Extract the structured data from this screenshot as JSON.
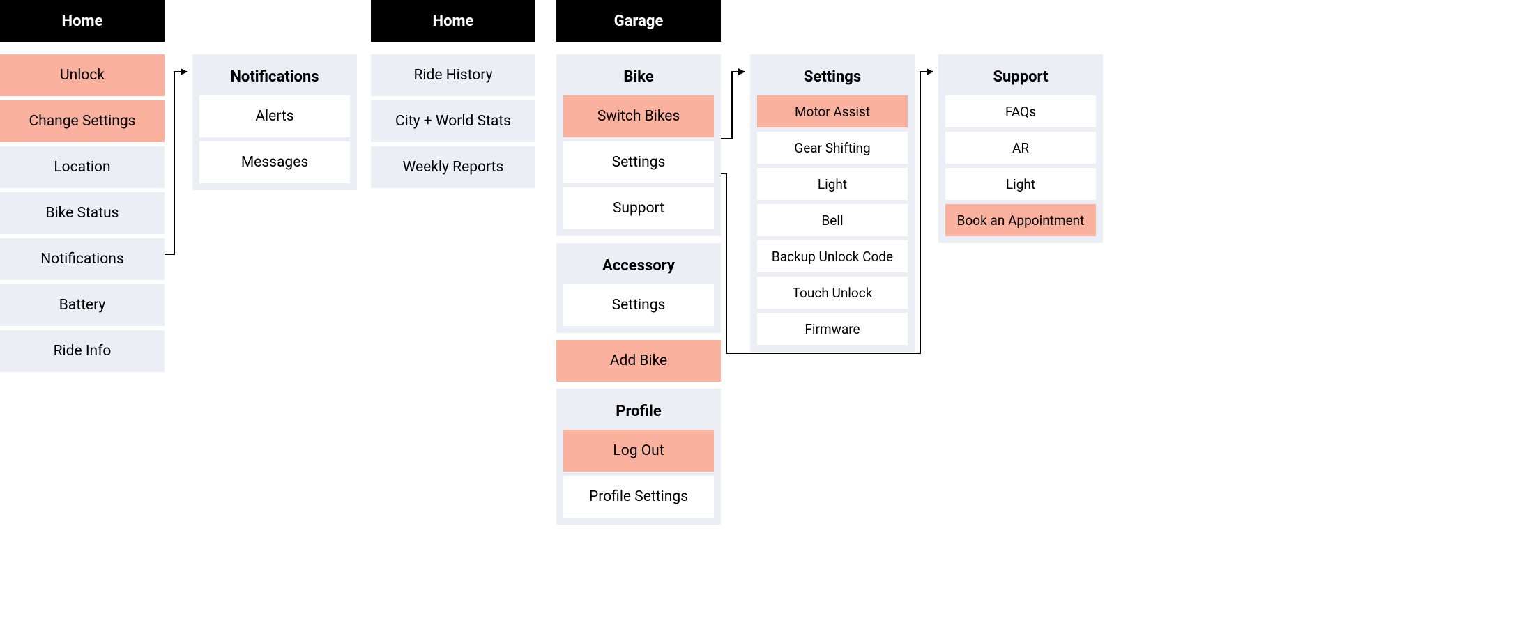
{
  "col1": {
    "header": "Home",
    "items": [
      {
        "label": "Unlock",
        "highlight": true
      },
      {
        "label": "Change Settings",
        "highlight": true
      },
      {
        "label": "Location",
        "highlight": false
      },
      {
        "label": "Bike Status",
        "highlight": false
      },
      {
        "label": "Notifications",
        "highlight": false
      },
      {
        "label": "Battery",
        "highlight": false
      },
      {
        "label": "Ride Info",
        "highlight": false
      }
    ]
  },
  "col2": {
    "title": "Notifications",
    "items": [
      {
        "label": "Alerts"
      },
      {
        "label": "Messages"
      }
    ]
  },
  "col3": {
    "header": "Home",
    "items": [
      {
        "label": "Ride History"
      },
      {
        "label": "City + World Stats"
      },
      {
        "label": "Weekly Reports"
      }
    ]
  },
  "col4": {
    "header": "Garage",
    "groups": [
      {
        "title": "Bike",
        "items": [
          {
            "label": "Switch Bikes",
            "highlight": true
          },
          {
            "label": "Settings",
            "highlight": false
          },
          {
            "label": "Support",
            "highlight": false
          }
        ]
      },
      {
        "title": "Accessory",
        "items": [
          {
            "label": "Settings",
            "highlight": false
          }
        ]
      }
    ],
    "add_bike": "Add Bike",
    "profile": {
      "title": "Profile",
      "items": [
        {
          "label": "Log Out",
          "highlight": true
        },
        {
          "label": "Profile Settings",
          "highlight": false
        }
      ]
    }
  },
  "col5": {
    "title": "Settings",
    "items": [
      {
        "label": "Motor Assist",
        "highlight": true
      },
      {
        "label": "Gear Shifting",
        "highlight": false
      },
      {
        "label": "Light",
        "highlight": false
      },
      {
        "label": "Bell",
        "highlight": false
      },
      {
        "label": "Backup Unlock Code",
        "highlight": false
      },
      {
        "label": "Touch Unlock",
        "highlight": false
      },
      {
        "label": "Firmware",
        "highlight": false
      }
    ]
  },
  "col6": {
    "title": "Support",
    "items": [
      {
        "label": "FAQs",
        "highlight": false
      },
      {
        "label": "AR",
        "highlight": false
      },
      {
        "label": "Light",
        "highlight": false
      },
      {
        "label": "Book an Appointment",
        "highlight": true
      }
    ]
  }
}
